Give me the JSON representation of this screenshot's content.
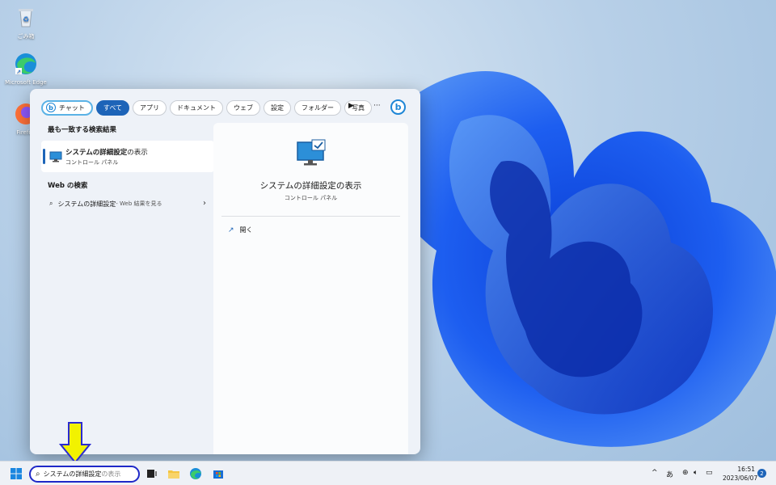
{
  "desktop": {
    "icons": [
      {
        "label": "ごみ箱",
        "icon": "recycle-bin-icon"
      },
      {
        "label": "Microsoft Edge",
        "icon": "edge-icon"
      },
      {
        "label": "Firefox",
        "icon": "firefox-icon"
      }
    ]
  },
  "search_panel": {
    "chips": [
      {
        "label": "チャット",
        "active": false
      },
      {
        "label": "すべて",
        "active": true
      },
      {
        "label": "アプリ",
        "active": false
      },
      {
        "label": "ドキュメント",
        "active": false
      },
      {
        "label": "ウェブ",
        "active": false
      },
      {
        "label": "設定",
        "active": false
      },
      {
        "label": "フォルダー",
        "active": false
      },
      {
        "label": "写真",
        "active": false
      }
    ],
    "play_label": "▶",
    "more_label": "···",
    "bing_label": "b",
    "best_match_heading": "最も一致する検索結果",
    "best_match": {
      "title_bold": "システムの詳細設定",
      "title_rest": "の表示",
      "subtitle": "コントロール パネル"
    },
    "web_heading": "Web の検索",
    "web_result": {
      "query": "システムの詳細設定",
      "suffix": " - Web 結果を見る"
    },
    "preview": {
      "title": "システムの詳細設定の表示",
      "subtitle": "コントロール パネル",
      "open_label": "開く"
    }
  },
  "taskbar": {
    "search_typed": "システムの詳細設定",
    "search_ghost": "の表示",
    "tray_ime": "あ",
    "tray_chevron": "^",
    "time": "16:51",
    "date": "2023/06/07",
    "notifications": "2"
  },
  "colors": {
    "accent": "#1d64b8",
    "search_highlight": "#1e28c8",
    "arrow": "#f2f200"
  }
}
